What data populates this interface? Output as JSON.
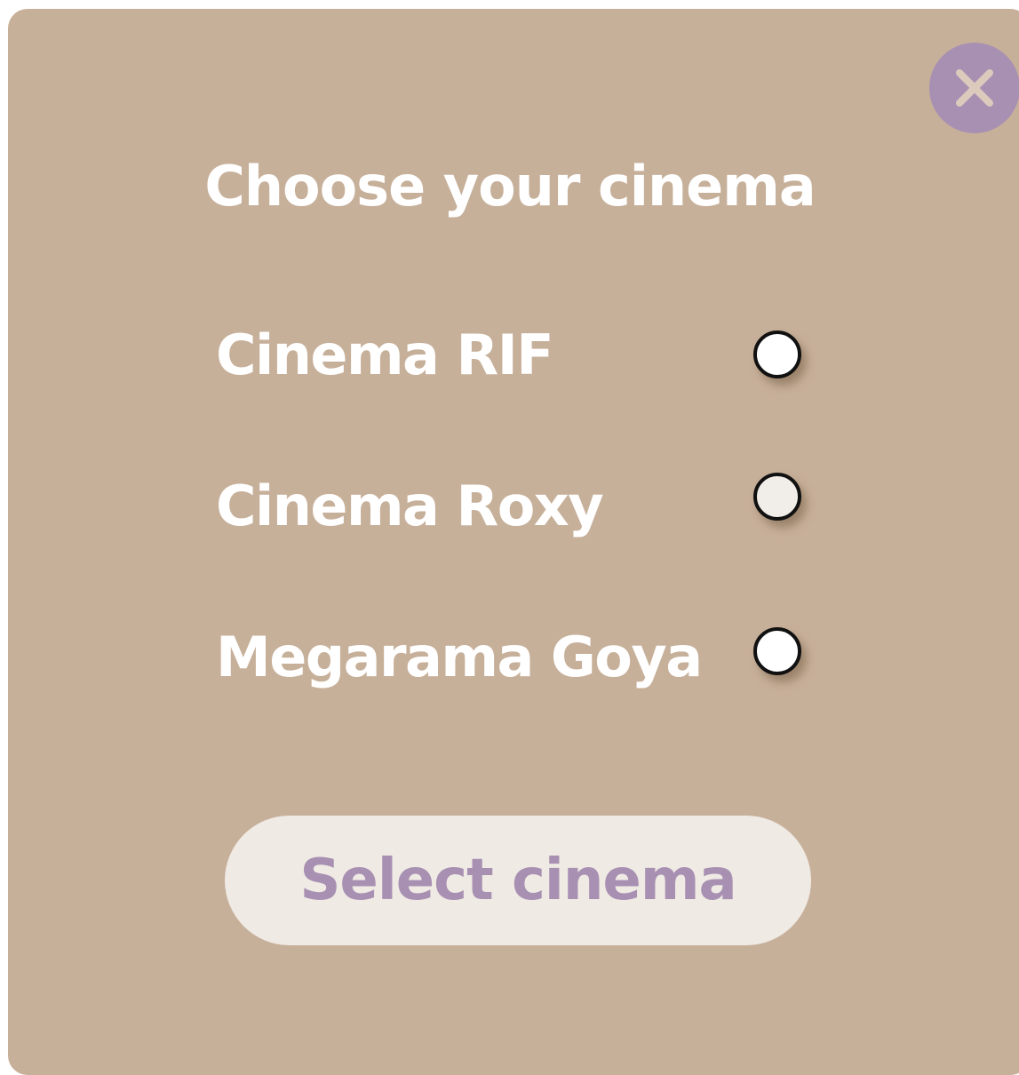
{
  "dialog": {
    "title": "Choose your cinema",
    "close_icon": "close-icon",
    "options": [
      {
        "label": "Cinema RIF",
        "selected": false
      },
      {
        "label": "Cinema Roxy",
        "selected": false
      },
      {
        "label": "Megarama Goya",
        "selected": false
      }
    ],
    "submit_label": "Select cinema"
  },
  "colors": {
    "background": "#c7b09a",
    "accent": "#a890b2",
    "button_bg": "#efeae4",
    "text": "#ffffff"
  }
}
